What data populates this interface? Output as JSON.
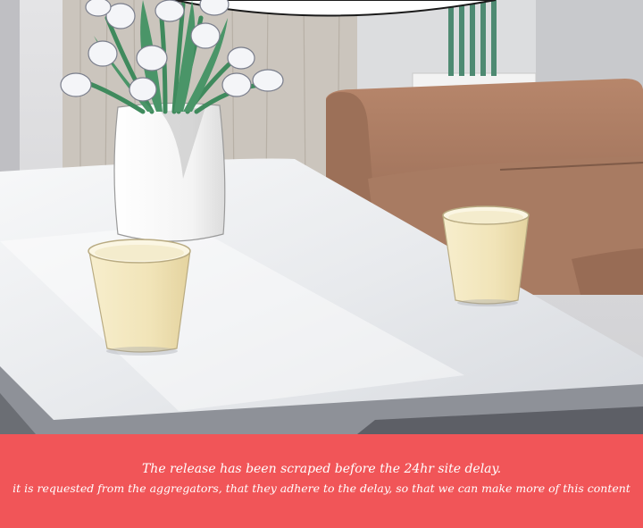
{
  "illustration": {
    "subject": "table-with-flower-vase-and-two-paper-cups",
    "colors": {
      "wall": "#d9d9db",
      "wood_panel": "#c9c3bb",
      "sofa": "#a77a60",
      "table_top": "#eef0f2",
      "vase": "#fafafa",
      "cup": "#f2e6bf",
      "leaves": "#3f8a5d"
    }
  },
  "notice": {
    "line1": "The release has been scraped before the 24hr site delay.",
    "line2": "it is requested from the aggregators, that they adhere to the delay, so that we can make more of this content",
    "background": "#f15558",
    "text_color": "#ffffff"
  }
}
